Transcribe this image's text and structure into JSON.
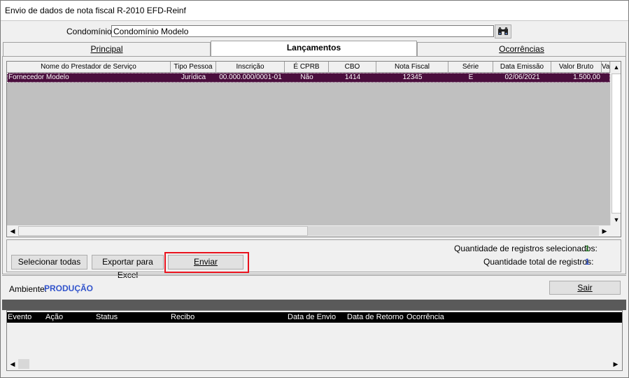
{
  "window": {
    "title": "Envio de dados de nota fiscal R-2010 EFD-Reinf"
  },
  "condominio": {
    "label": "Condomínio:",
    "value": "Condomínio Modelo",
    "search_icon": "binoculars-icon"
  },
  "tabs": [
    {
      "label": "Principal",
      "active": false
    },
    {
      "label": "Lançamentos",
      "active": true
    },
    {
      "label": "Ocorrências",
      "active": false
    }
  ],
  "grid": {
    "columns": [
      "Nome do Prestador de Serviço",
      "Tipo Pessoa",
      "Inscrição",
      "É CPRB",
      "CBO",
      "Nota Fiscal",
      "Série",
      "Data Emissão",
      "Valor Bruto",
      "Va"
    ],
    "rows": [
      {
        "prestador": "Fornecedor Modelo",
        "tipo": "Jurídica",
        "inscricao": "00.000.000/0001-01",
        "cprb": "Não",
        "cbo": "1414",
        "nota": "12345",
        "serie": "E",
        "data": "02/06/2021",
        "valor": "1.500,00"
      }
    ],
    "selected_row_color": "#4a0e3d"
  },
  "actions": {
    "select_all": "Selecionar todas",
    "export_excel": "Exportar para Excel",
    "send": "Enviar",
    "highlight_color": "#e8121d"
  },
  "counts": {
    "selected_label": "Quantidade de registros selecionados:",
    "selected_value": "1",
    "total_label": "Quantidade total de registros:",
    "total_value": "1"
  },
  "ambiente": {
    "label": "Ambiente:",
    "value": "PRODUÇÃO"
  },
  "sair": "Sair",
  "log": {
    "columns": [
      "Evento",
      "Ação",
      "Status",
      "Recibo",
      "Data de Envio",
      "Data de Retorno",
      "Ocorrência"
    ]
  }
}
